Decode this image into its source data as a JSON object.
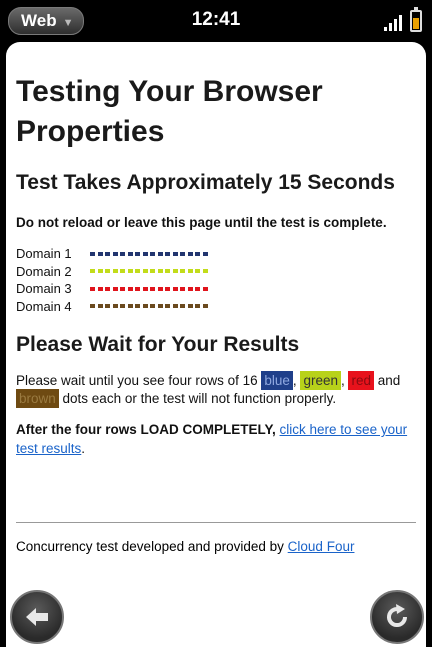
{
  "status_bar": {
    "app_menu_label": "Web",
    "time": "12:41"
  },
  "page": {
    "title": "Testing Your Browser Properties",
    "subtitle": "Test Takes Approximately 15 Seconds",
    "warning": "Do not reload or leave this page until the test is complete.",
    "domains": [
      {
        "label": "Domain 1",
        "color": "#22356f",
        "dots": 16
      },
      {
        "label": "Domain 2",
        "color": "#c2dc1a",
        "dots": 16
      },
      {
        "label": "Domain 3",
        "color": "#e0141c",
        "dots": 16
      },
      {
        "label": "Domain 4",
        "color": "#6b4a1e",
        "dots": 16
      }
    ],
    "results_heading": "Please Wait for Your Results",
    "instructions": {
      "before": "Please wait until you see four rows of 16 ",
      "blue": "blue",
      "sep1": ", ",
      "green": "green",
      "sep2": ", ",
      "red": "red",
      "and": " and ",
      "brown": "brown",
      "after": " dots each or the test will not function properly."
    },
    "after_load": {
      "bold": "After the four rows LOAD COMPLETELY, ",
      "link": "click here to see your test results",
      "end": "."
    },
    "footer": {
      "text": "Concurrency test developed and provided by ",
      "link": "Cloud Four"
    }
  },
  "toolbar": {
    "back_icon": "back-arrow-icon",
    "reload_icon": "reload-icon"
  }
}
